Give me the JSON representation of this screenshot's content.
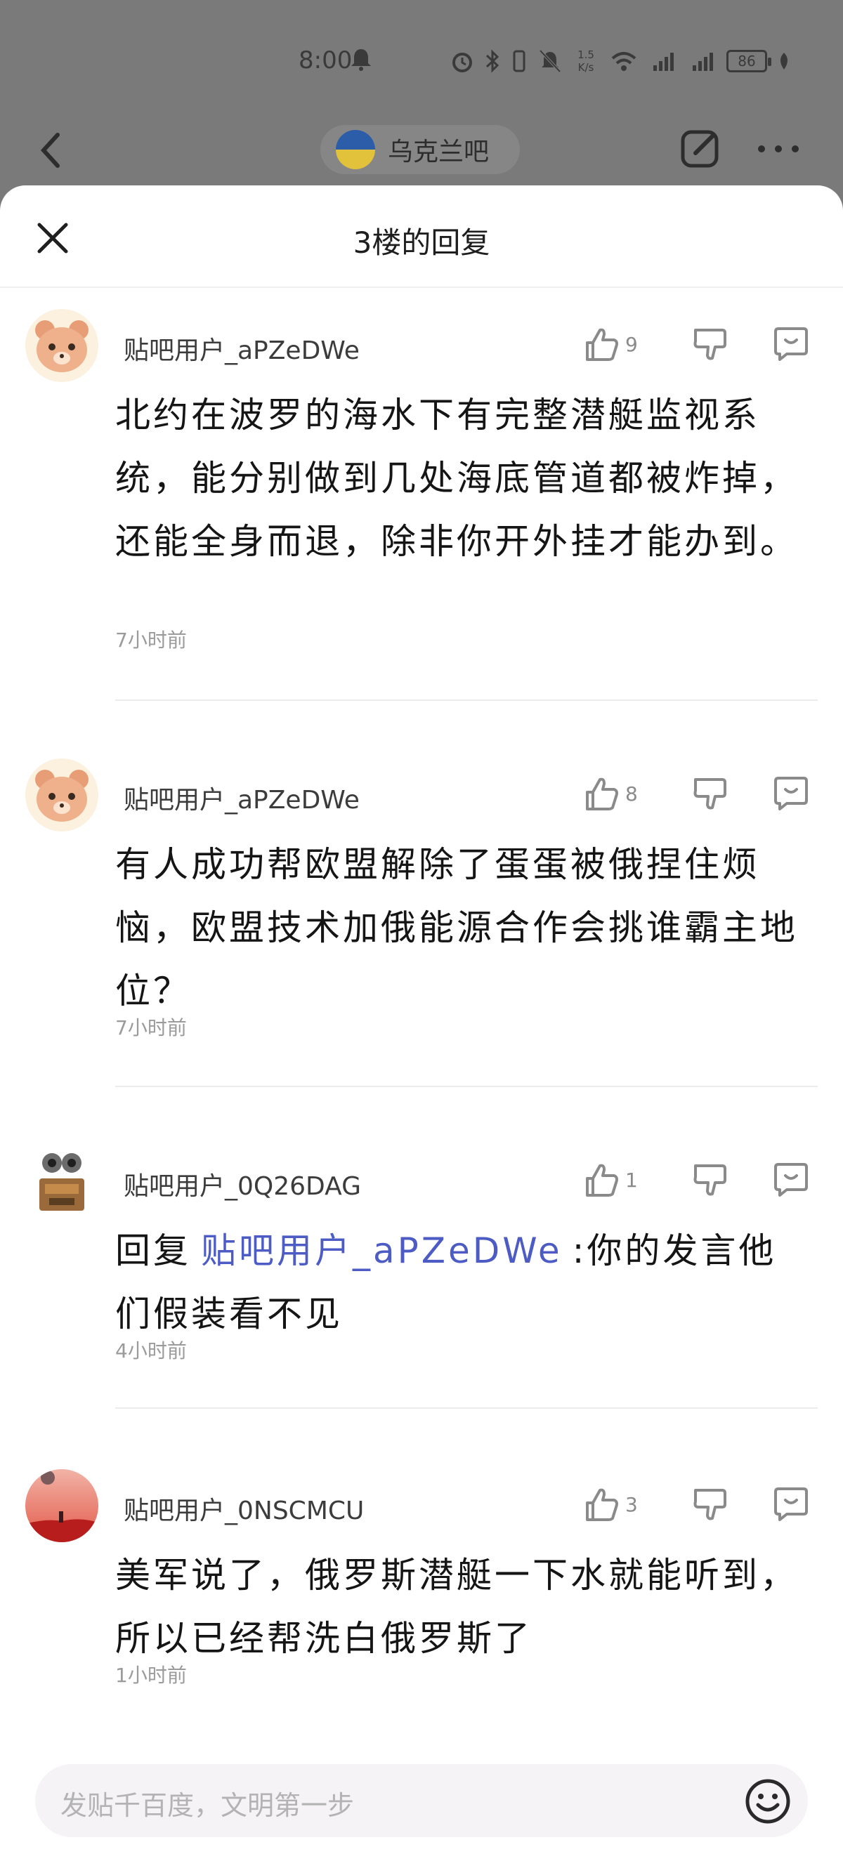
{
  "status_bar": {
    "time": "8:00",
    "net_speed_value": "1.5",
    "net_speed_unit": "K/s",
    "battery": "86"
  },
  "top_nav": {
    "forum_name": "乌克兰吧"
  },
  "sheet": {
    "title": "3楼的回复"
  },
  "replies": [
    {
      "username": "贴吧用户_aPZeDWe",
      "likes": "9",
      "content": "北约在波罗的海水下有完整潜艇监视系统，能分别做到几处海底管道都被炸掉，还能全身而退，除非你开外挂才能办到。",
      "time": "7小时前",
      "avatar": "bear-avatar"
    },
    {
      "username": "贴吧用户_aPZeDWe",
      "likes": "8",
      "content": "有人成功帮欧盟解除了蛋蛋被俄捏住烦恼，欧盟技术加俄能源合作会挑谁霸主地位？",
      "time": "7小时前",
      "avatar": "bear-avatar"
    },
    {
      "username": "贴吧用户_0Q26DAG",
      "likes": "1",
      "reply_prefix": "回复",
      "mention": "贴吧用户_aPZeDWe",
      "content": ":你的发言他们假装看不见",
      "time": "4小时前",
      "avatar": "robot-avatar"
    },
    {
      "username": "贴吧用户_0NSCMCU",
      "likes": "3",
      "content": "美军说了，俄罗斯潜艇一下水就能听到，所以已经帮洗白俄罗斯了",
      "time": "1小时前",
      "avatar": "sunset-avatar"
    }
  ],
  "input": {
    "placeholder": "发贴千百度，文明第一步"
  },
  "colors": {
    "mention": "#4d5cc4",
    "overlay": "#7a7a7a",
    "flag_blue": "#2b5da8",
    "flag_yellow": "#e1c23a"
  }
}
